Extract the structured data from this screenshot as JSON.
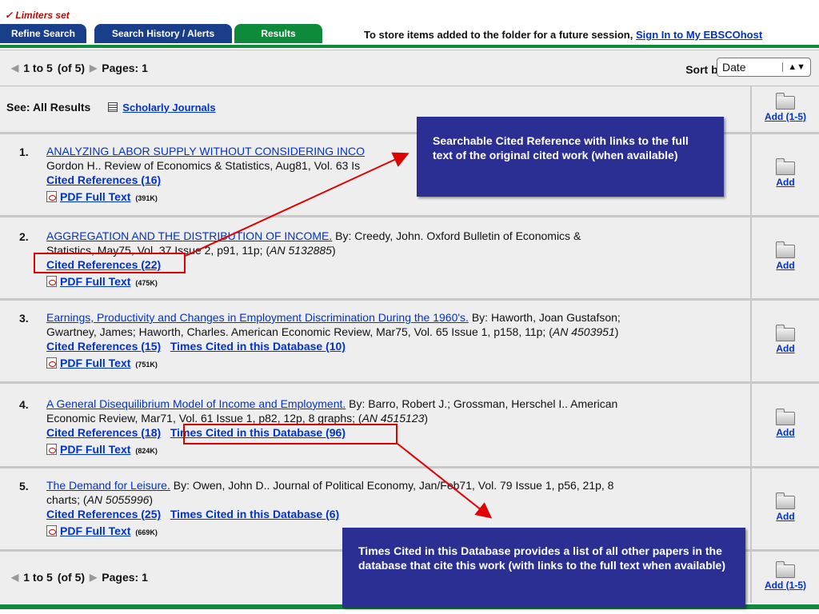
{
  "limiters": "✓ Limiters set",
  "tabs": {
    "refine": "Refine Search",
    "history": "Search History / Alerts",
    "results": "Results"
  },
  "store_msg": {
    "text": "To store items added to the folder for a future session,",
    "link": "Sign In to My EBSCOhost"
  },
  "nav": {
    "range": "1 to 5",
    "of": "(of 5)",
    "pages": "Pages: 1"
  },
  "sort": {
    "label": "Sort by :",
    "value": "Date"
  },
  "see": {
    "label": "See: All Results",
    "link": "Scholarly Journals",
    "add_label": "Add (1-5)"
  },
  "results": [
    {
      "num": "1.",
      "title": "ANALYZING LABOR SUPPLY WITHOUT CONSIDERING INCO",
      "line2": "Gordon H.. Review of Economics & Statistics, Aug81, Vol. 63 Is",
      "cited": "Cited References (16)",
      "times": "",
      "pdf": "PDF Full Text",
      "size": "(391K)",
      "add": "Add"
    },
    {
      "num": "2.",
      "title": "AGGREGATION AND THE DISTRIBUTION OF INCOME.",
      "by": " By: Creedy, John. Oxford Bulletin of Economics &",
      "line2": "Statistics, May75, Vol. 37 Issue 2, p91, 11p; (",
      "an": "AN 5132885",
      "line2_end": ")",
      "cited": "Cited References (22)",
      "times": "",
      "pdf": "PDF Full Text",
      "size": "(475K)",
      "add": "Add"
    },
    {
      "num": "3.",
      "title": "Earnings, Productivity and Changes in Employment Discrimination During the 1960's.",
      "by": " By: Haworth, Joan Gustafson;",
      "line2": "Gwartney, James; Haworth, Charles. American Economic Review, Mar75, Vol. 65 Issue 1, p158, 11p; (",
      "an": "AN 4503951",
      "line2_end": ")",
      "cited": "Cited References (15)",
      "times": "Times Cited in this Database (10)",
      "pdf": "PDF Full Text",
      "size": "(751K)",
      "add": "Add"
    },
    {
      "num": "4.",
      "title": "A General Disequilibrium Model of Income and Employment.",
      "by": " By: Barro, Robert J.; Grossman, Herschel I.. American",
      "line2": "Economic Review, Mar71, Vol. 61 Issue 1, p82, 12p, 8 graphs; (",
      "an": "AN 4515123",
      "line2_end": ")",
      "cited": "Cited References (18)",
      "times": "Times Cited in this Database (96)",
      "pdf": "PDF Full Text",
      "size": "(824K)",
      "add": "Add"
    },
    {
      "num": "5.",
      "title": "The Demand for Leisure.",
      "by": " By: Owen, John D.. Journal of Political Economy, Jan/Feb71, Vol. 79 Issue 1, p56, 21p, 8",
      "line2": "charts; (",
      "an": "AN 5055996",
      "line2_end": ")",
      "cited": "Cited References (25)",
      "times": "Times Cited in this Database (6)",
      "pdf": "PDF Full Text",
      "size": "(669K)",
      "add": "Add"
    }
  ],
  "bottom_add": "Add (1-5)",
  "callouts": {
    "top": "Searchable Cited Reference with links to the full text of the original cited work (when available)",
    "bottom": "Times Cited in this Database provides a list of all other papers in the database that cite this work (with links to the full text when available)"
  },
  "colors": {
    "tab_blue": "#1a3f8a",
    "tab_green": "#0d8a3a",
    "callout_bg": "#2b2f94",
    "link": "#0033cc",
    "highlight": "#e00000"
  }
}
